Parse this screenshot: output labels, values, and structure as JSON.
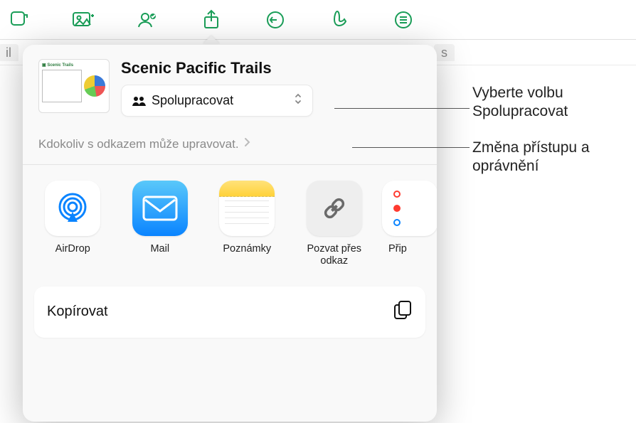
{
  "toolbar_icons": [
    "shape-icon",
    "image-icon",
    "people-icon",
    "share-icon",
    "undo-icon",
    "brush-icon",
    "menu-icon"
  ],
  "tabs": {
    "left_edge": "il",
    "right_edge": "s"
  },
  "sheet": {
    "doc_title": "Scenic Pacific Trails",
    "mode": {
      "label": "Spolupracovat",
      "icon": "people-small-icon"
    },
    "permission": {
      "text": "Kdokoliv s odkazem může upravovat."
    },
    "apps": [
      {
        "key": "airdrop",
        "label": "AirDrop"
      },
      {
        "key": "mail",
        "label": "Mail"
      },
      {
        "key": "notes",
        "label": "Poznámky"
      },
      {
        "key": "invite",
        "label": "Pozvat přes odkaz"
      },
      {
        "key": "more",
        "label": "Přip"
      }
    ],
    "copy_row": {
      "label": "Kopírovat",
      "icon": "copy-icon"
    }
  },
  "callouts": {
    "c1": "Vyberte volbu Spolupracovat",
    "c2": "Změna přístupu a oprávnění"
  }
}
